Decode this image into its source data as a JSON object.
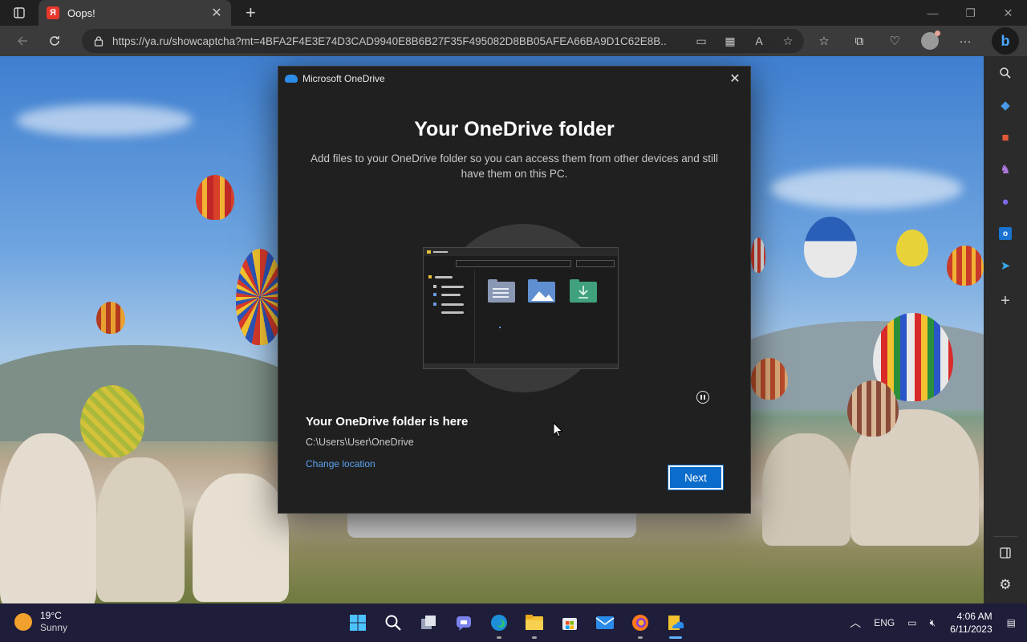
{
  "browser": {
    "tab": {
      "favicon": "Я",
      "title": "Oops!"
    },
    "url": "https://ya.ru/showcaptcha?mt=4BFA2F4E3E74D3CAD9940E8B6B27F35F495082D8BB05AFEA66BA9D1C62E8B...",
    "icons": [
      "tab-actions-icon",
      "close-icon",
      "plus-icon",
      "back-icon",
      "reload-icon",
      "lock-icon",
      "app-available-icon",
      "immersive-reader-icon",
      "read-aloud-icon",
      "favorite-star-icon",
      "favorites-icon",
      "collections-icon",
      "performance-icon",
      "profile-icon",
      "more-icon",
      "bing-icon"
    ]
  },
  "dialog": {
    "app_title": "Microsoft OneDrive",
    "heading": "Your OneDrive folder",
    "description": "Add files to your OneDrive folder so you can access them from other devices and still have them on this PC.",
    "location_title": "Your OneDrive folder is here",
    "location_path": "C:\\Users\\User\\OneDrive",
    "change_location": "Change location",
    "next": "Next",
    "folder_colors": {
      "docs": "#8a98b4",
      "pictures": "#5f8fd0",
      "downloads": "#3fa27d"
    }
  },
  "sidebar": {
    "icons": [
      "search-icon",
      "shopping-tag-icon",
      "tools-icon",
      "games-icon",
      "office-icon",
      "outlook-icon",
      "telegram-icon",
      "add-icon",
      "sidebar-layout-icon",
      "settings-icon"
    ]
  },
  "taskbar": {
    "weather_temp": "19°C",
    "weather_cond": "Sunny",
    "apps": [
      "start",
      "search",
      "task-view",
      "teams-chat",
      "edge",
      "file-explorer",
      "store",
      "mail",
      "firefox",
      "onedrive-setup"
    ],
    "lang": "ENG",
    "time": "4:06 AM",
    "date": "6/11/2023"
  },
  "colors": {
    "accent": "#0a6ccb",
    "link": "#5aa3ef",
    "dialog_bg": "#202020",
    "taskbar_bg": "#1e1d3a"
  }
}
